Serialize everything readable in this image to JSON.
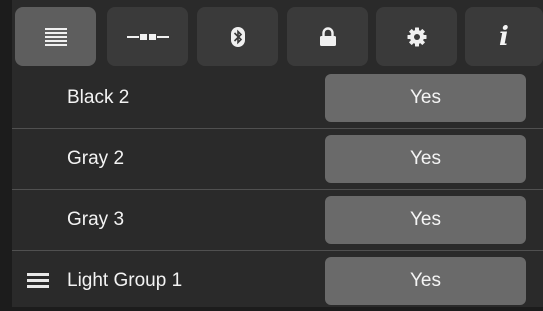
{
  "tabs": [
    {
      "id": "list",
      "icon": "list-icon",
      "active": true
    },
    {
      "id": "connector",
      "icon": "connector-icon",
      "active": false
    },
    {
      "id": "bluetooth",
      "icon": "bluetooth-icon",
      "active": false
    },
    {
      "id": "lock",
      "icon": "lock-icon",
      "active": false
    },
    {
      "id": "settings",
      "icon": "gear-icon",
      "active": false
    },
    {
      "id": "info",
      "icon": "info-icon",
      "label": "i",
      "active": false
    }
  ],
  "rows": [
    {
      "label": "Black 2",
      "value": "Yes",
      "drag_handle": false
    },
    {
      "label": "Gray 2",
      "value": "Yes",
      "drag_handle": false
    },
    {
      "label": "Gray 3",
      "value": "Yes",
      "drag_handle": false
    },
    {
      "label": "Light Group 1",
      "value": "Yes",
      "drag_handle": true
    }
  ],
  "colors": {
    "background": "#2a2a2a",
    "tab": "#3a3a3a",
    "tab_active": "#5e5e5e",
    "value_button": "#6a6a6a",
    "text": "#f3f3f3"
  }
}
